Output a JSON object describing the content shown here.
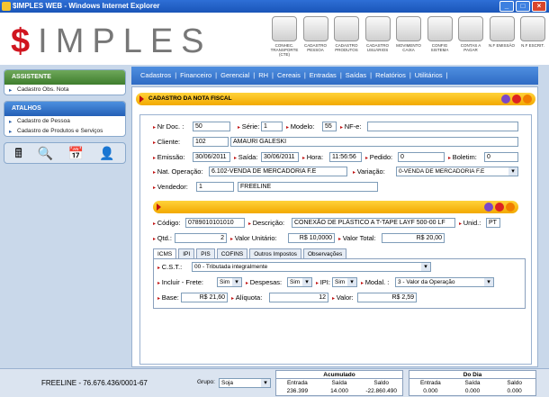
{
  "window": {
    "title": "$IMPLES WEB - Windows Internet Explorer",
    "min": "_",
    "max": "□",
    "close": "×"
  },
  "logo": {
    "dollar": "$",
    "rest": "IMPLES"
  },
  "toolbar": [
    {
      "label": "CONHEC. TRANSPORTE (CTE)",
      "icon": "truck-icon"
    },
    {
      "label": "CADASTRO PESSOA",
      "icon": "person-icon"
    },
    {
      "label": "CADASTRO PRODUTOS",
      "icon": "box-icon"
    },
    {
      "label": "CADASTRO USUÁRIOS",
      "icon": "user-icon"
    },
    {
      "label": "MOVIMENTO CAIXA",
      "icon": "register-icon"
    },
    {
      "label": "CONFIG SISTEMA",
      "icon": "gear-icon"
    },
    {
      "label": "CONTAS A PAGAR",
      "icon": "money-bag-icon"
    },
    {
      "label": "N.F EMISSÃO",
      "icon": "invoice-icon"
    },
    {
      "label": "N.F ESCRIT.",
      "icon": "invoice-list-icon"
    }
  ],
  "sidebar": {
    "assistente": {
      "title": "ASSISTENTE",
      "items": [
        "Cadastro Obs. Nota"
      ]
    },
    "atalhos": {
      "title": "ATALHOS",
      "items": [
        "Cadastro de Pessoa",
        "Cadastro de Produtos e Serviços"
      ]
    },
    "icons": [
      "🖩",
      "🔍",
      "📅",
      "👤"
    ]
  },
  "menu": [
    "Cadastros",
    "|",
    "Financeiro",
    "|",
    "Gerencial",
    "|",
    "RH",
    "|",
    "Cereais",
    "|",
    "Entradas",
    "|",
    "Saídas",
    "|",
    "Relatórios",
    "|",
    "Utilitários",
    "|"
  ],
  "section": {
    "title": "CADASTRO DA NOTA FISCAL"
  },
  "form": {
    "nr_doc_label": "Nr Doc. :",
    "nr_doc": "50",
    "serie_label": "Série:",
    "serie": "1",
    "modelo_label": "Modelo:",
    "modelo": "55",
    "nfe_label": "NF-e:",
    "nfe": "",
    "cliente_label": "Cliente:",
    "cliente_cod": "102",
    "cliente_nome": "AMAURI GALESKI",
    "emissao_label": "Emissão:",
    "emissao": "30/06/2011",
    "saida_label": "Saída:",
    "saida": "30/06/2011",
    "hora_label": "Hora:",
    "hora": "11:56:56",
    "pedido_label": "Pedido:",
    "pedido": "0",
    "boletim_label": "Boletim:",
    "boletim": "0",
    "natop_label": "Nat. Operação:",
    "natop": "6.102-VENDA DE MERCADORIA F.E",
    "variacao_label": "Variação:",
    "variacao": "0-VENDA DE MERCADORIA F.E",
    "vendedor_label": "Vendedor:",
    "vendedor_cod": "1",
    "vendedor_nome": "FREELINE"
  },
  "item": {
    "codigo_label": "Código:",
    "codigo": "0789010101010",
    "descricao_label": "Descrição:",
    "descricao": "CONEXÃO DE PLÁSTICO A T-TAPE LAYF 500-00 LF",
    "unid_label": "Unid.:",
    "unid": "PT",
    "qtd_label": "Qtd.:",
    "qtd": "2",
    "vunit_label": "Valor Unitário:",
    "vunit": "R$ 10,0000",
    "vtotal_label": "Valor Total:",
    "vtotal": "R$ 20,00"
  },
  "tabs": [
    "ICMS",
    "IPI",
    "PIS",
    "COFINS",
    "Outros Impostos",
    "Observações"
  ],
  "icms": {
    "cst_label": "C.S.T.:",
    "cst": "00 - Tributada integralmente",
    "frete_label": "Incluir - Frete:",
    "frete": "Sim",
    "despesas_label": "Despesas:",
    "despesas": "Sim",
    "ipi_label": "IPI:",
    "ipi": "Sim",
    "modal_label": "Modal. :",
    "modal": "3 - Valor da Operação",
    "base_label": "Base:",
    "base": "R$ 21,60",
    "aliquota_label": "Alíquota:",
    "aliquota": "12",
    "valor_label": "Valor:",
    "valor": "R$ 2,59"
  },
  "status": {
    "text": "FREELINE - 76.676.436/0001-67",
    "grupo_label": "Grupo:",
    "grupo": "Soja",
    "acumulado": {
      "title": "Acumulado",
      "h": [
        "Entrada",
        "Saída",
        "Saldo"
      ],
      "v": [
        "236.399",
        "14.000",
        "-22.860.490"
      ]
    },
    "dodia": {
      "title": "Do Dia",
      "h": [
        "Entrada",
        "Saída",
        "Saldo"
      ],
      "v": [
        "0.000",
        "0.000",
        "0.000"
      ]
    }
  }
}
